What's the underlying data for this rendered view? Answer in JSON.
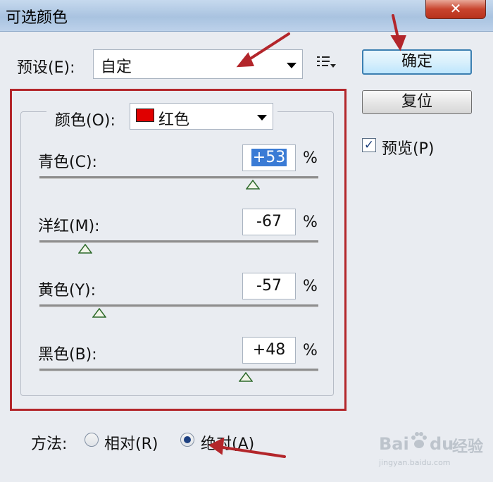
{
  "window": {
    "title": "可选颜色",
    "close_label": "✕"
  },
  "preset": {
    "label": "预设(E):",
    "value": "自定"
  },
  "buttons": {
    "ok": "确定",
    "reset": "复位"
  },
  "preview": {
    "label": "预览(P)",
    "checked": true
  },
  "colors": {
    "label": "颜色(O):",
    "value": "红色",
    "swatch": "#e00000"
  },
  "sliders": [
    {
      "label": "青色(C):",
      "value": "+53",
      "unit": "%",
      "level": 53
    },
    {
      "label": "洋红(M):",
      "value": "-67",
      "unit": "%",
      "level": -67
    },
    {
      "label": "黄色(Y):",
      "value": "-57",
      "unit": "%",
      "level": -57
    },
    {
      "label": "黑色(B):",
      "value": "+48",
      "unit": "%",
      "level": 48
    }
  ],
  "method": {
    "label": "方法:",
    "options": [
      {
        "label": "相对(R)",
        "selected": false
      },
      {
        "label": "绝对(A)",
        "selected": true
      }
    ]
  },
  "watermark": {
    "brand": "Bai du",
    "suffix": "经验",
    "sub": "jingyan.baidu.com"
  },
  "annotation_color": "#b3262b",
  "accent": "#3c7fb1"
}
